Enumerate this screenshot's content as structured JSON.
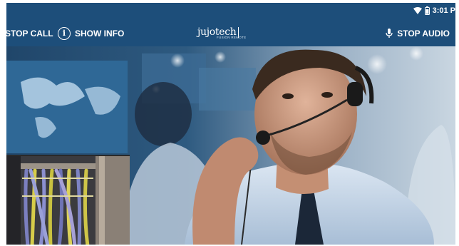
{
  "status_bar": {
    "time": "3:01 P",
    "icons": [
      "wifi-icon",
      "battery-icon"
    ]
  },
  "toolbar": {
    "stop_call_label": "STOP CALL",
    "show_info_label": "SHOW INFO",
    "show_info_icon": "info-icon",
    "stop_audio_label": "STOP AUDIO",
    "stop_audio_icon": "microphone-icon"
  },
  "logo": {
    "brand": "jujotech",
    "subtitle": "FUSION REMOTE"
  },
  "video": {
    "main_feed": "remote-agent-video",
    "self_view": "local-camera-cables-video"
  },
  "colors": {
    "bar_background": "#1d4e7a",
    "bar_text": "#ffffff"
  }
}
